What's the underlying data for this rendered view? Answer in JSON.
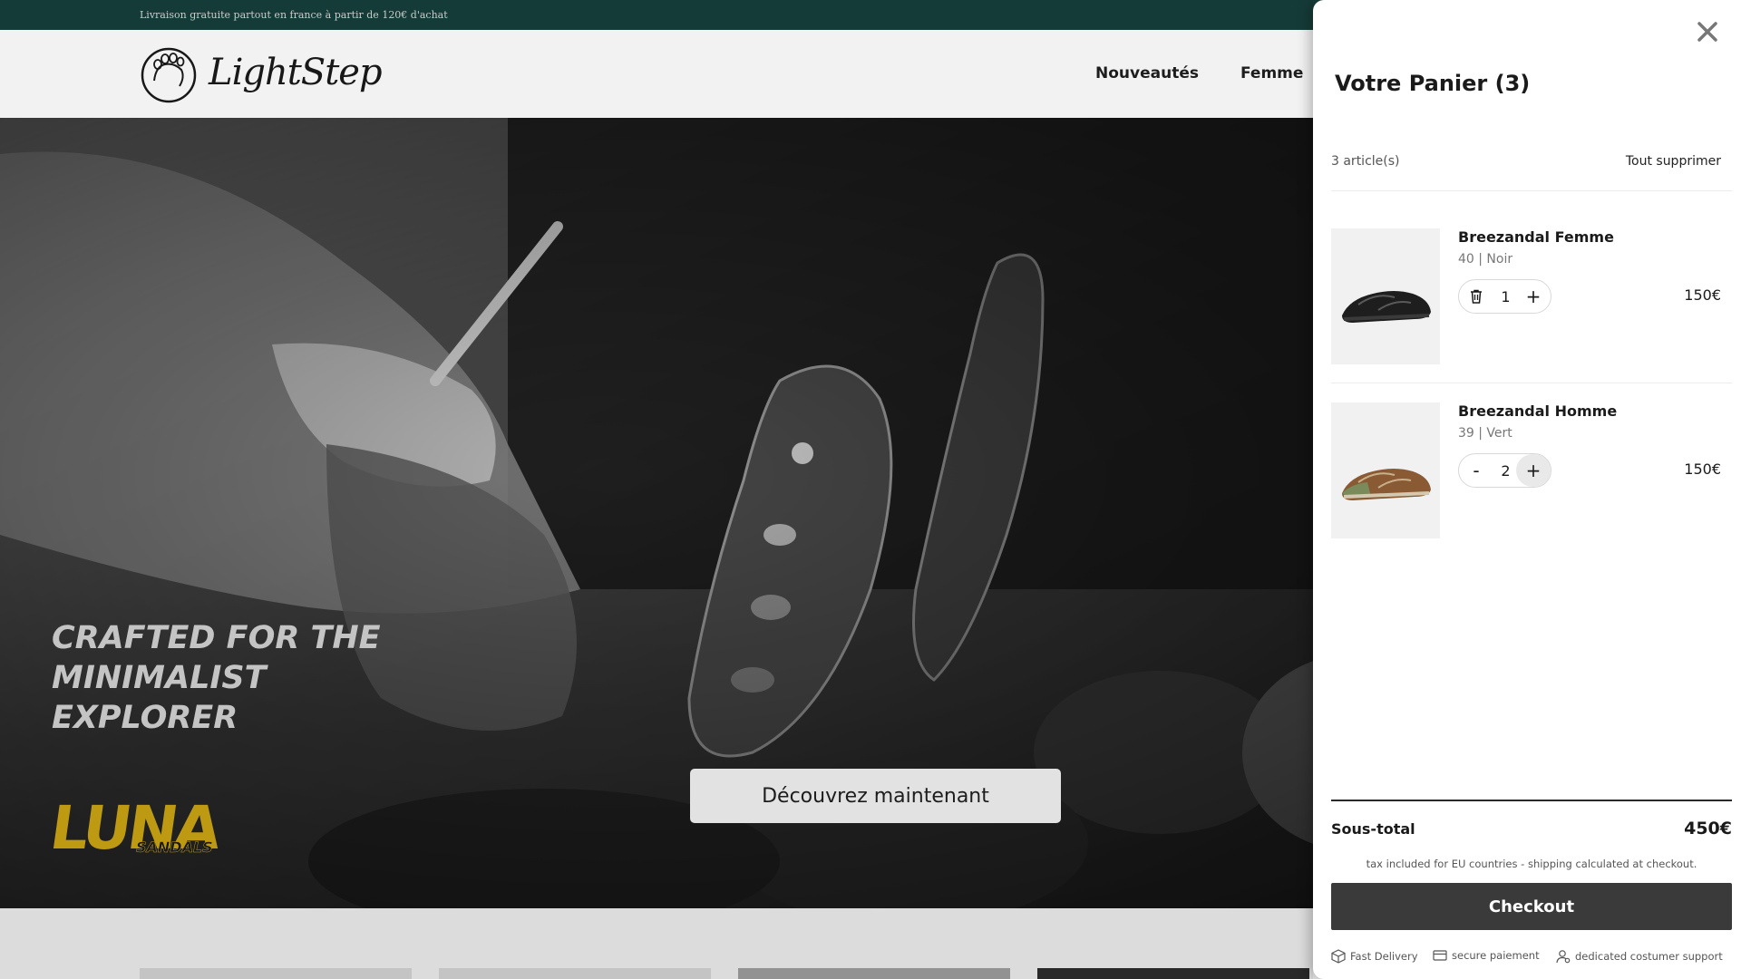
{
  "announcement": {
    "text": "Livraison gratuite partout en france à partir de 120€ d'achat"
  },
  "header": {
    "logo_text": "LightStep",
    "nav": [
      {
        "label": "Nouveautés"
      },
      {
        "label": "Femme"
      }
    ]
  },
  "hero": {
    "title_lines": [
      "CRAFTED FOR THE",
      "MINIMALIST",
      "EXPLORER"
    ],
    "cta_label": "Découvrez maintenant",
    "brand_main": "LUNA",
    "brand_sub": "SANDALS"
  },
  "cart": {
    "title": "Votre Panier (3)",
    "count_text": "3 article(s)",
    "clear_all": "Tout supprimer",
    "items": [
      {
        "name": "Breezandal Femme",
        "variant": "40 | Noir",
        "quantity": "1",
        "price": "150€",
        "left_control": "trash-icon",
        "image_color": "#1e1e1e"
      },
      {
        "name": "Breezandal Homme",
        "variant": "39 | Vert",
        "quantity": "2",
        "price": "150€",
        "left_control": "-",
        "image_color": "#8a5a34"
      }
    ],
    "plus_label": "+",
    "subtotal_label": "Sous-total",
    "subtotal_value": "450€",
    "tax_note": "tax included for EU countries - shipping calculated at checkout.",
    "checkout_label": "Checkout",
    "badges": [
      {
        "icon": "box-icon",
        "label": "Fast Delivery"
      },
      {
        "icon": "card-icon",
        "label": "secure paiement"
      },
      {
        "icon": "support-icon",
        "label": "dedicated costumer support"
      }
    ]
  },
  "colors": {
    "announcement_bg": "#173f3b",
    "brand_yellow": "#c9a313",
    "checkout_bg": "#3a3a3a"
  }
}
